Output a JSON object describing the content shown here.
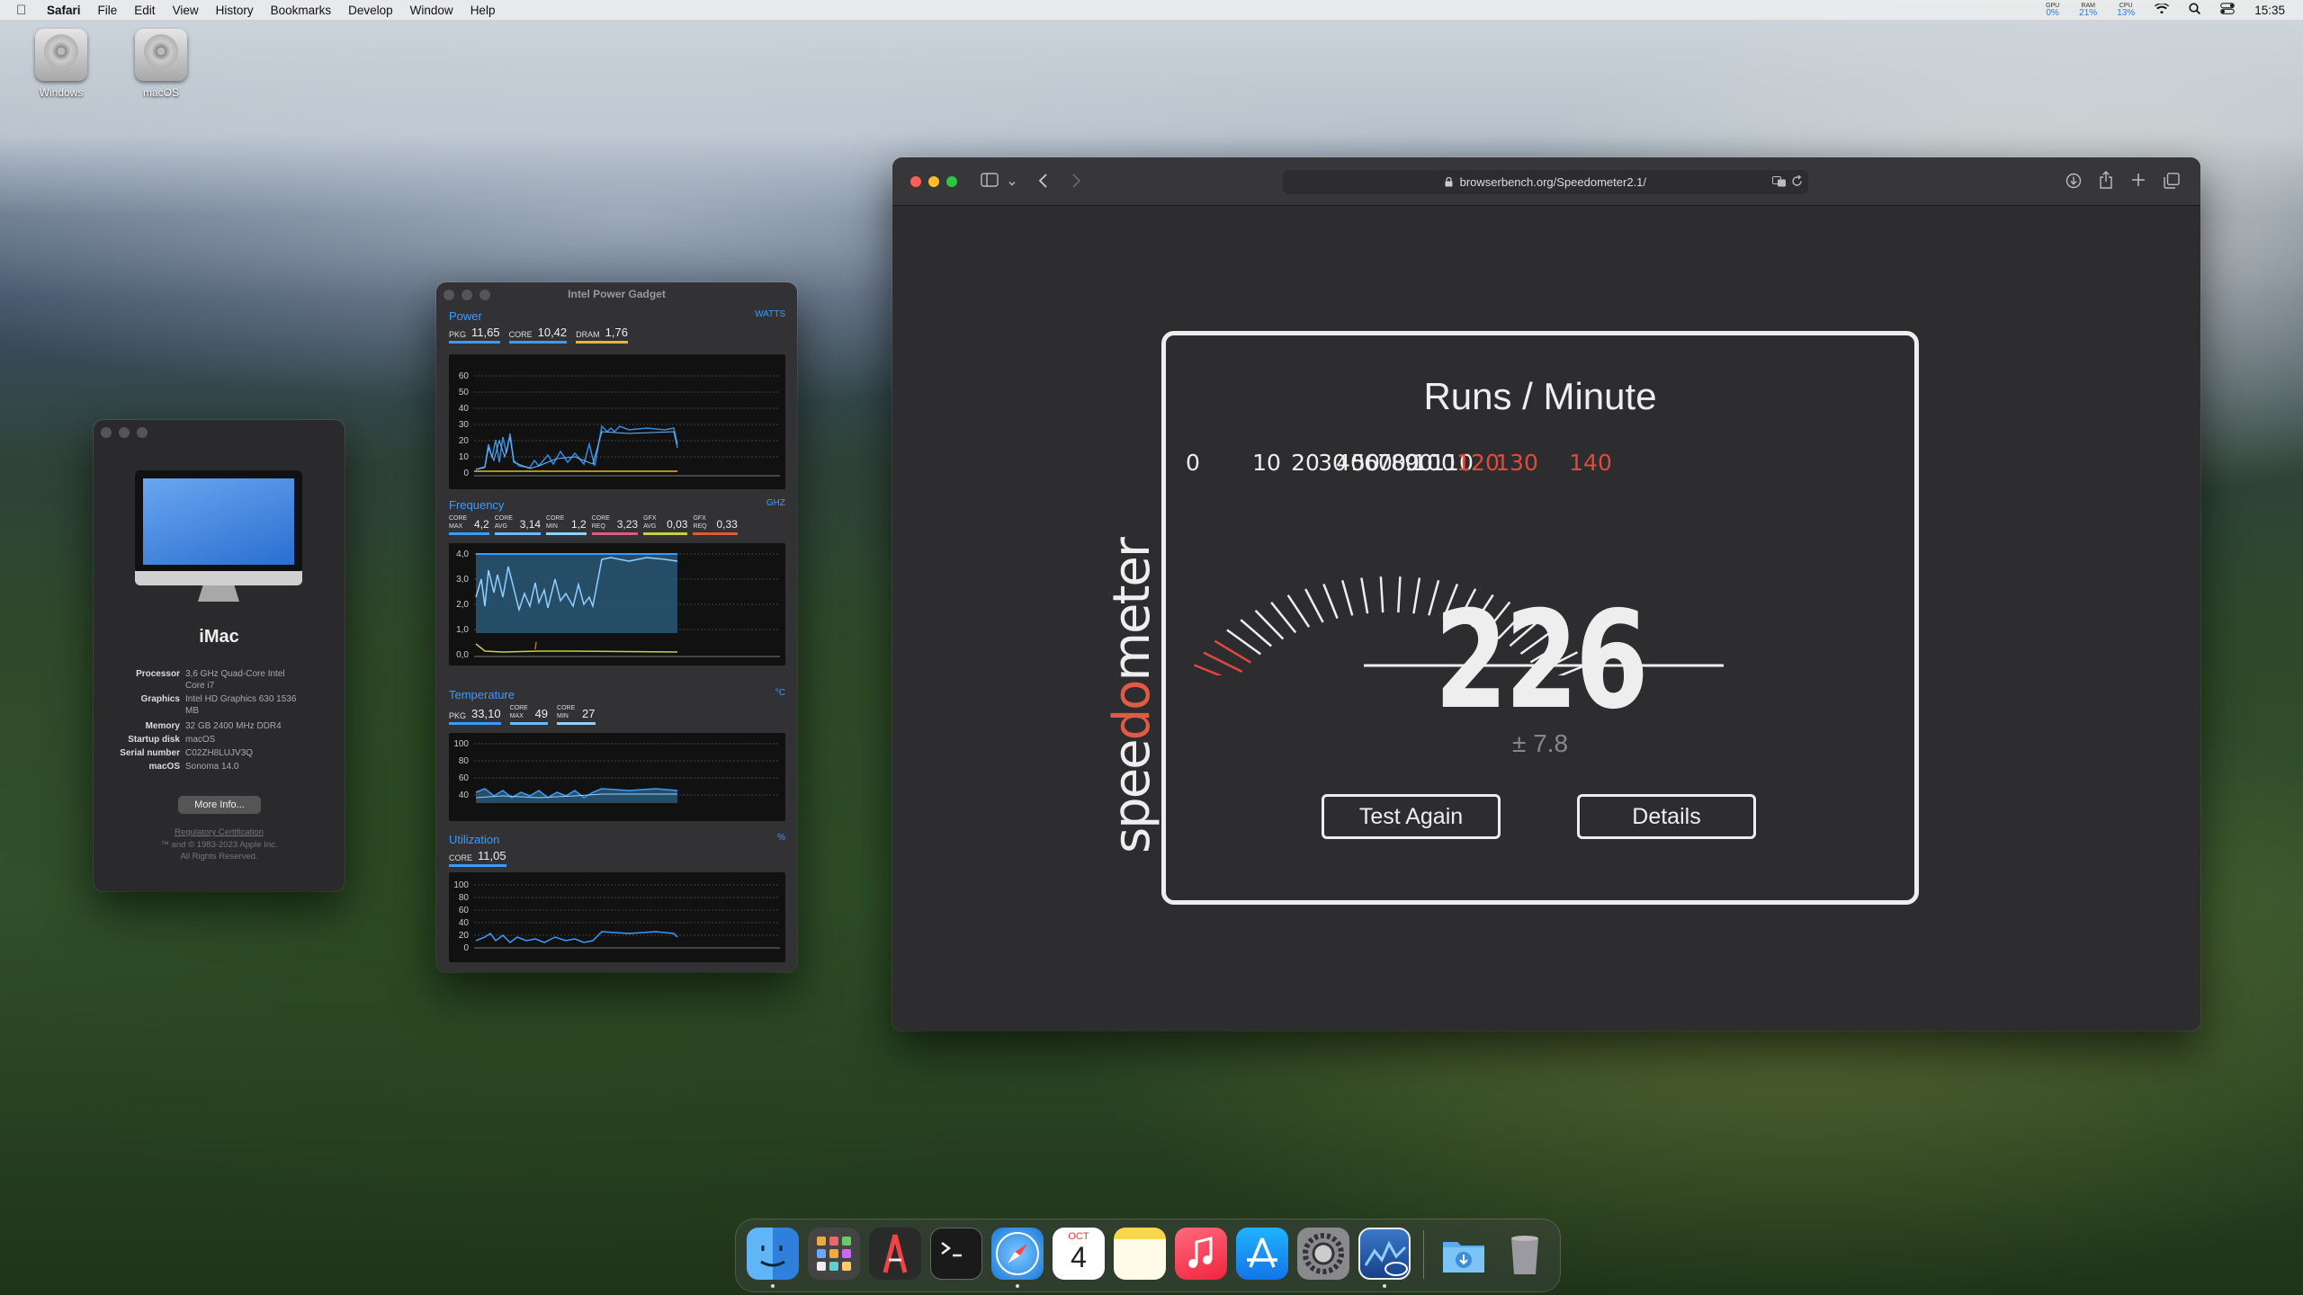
{
  "menubar": {
    "app_name": "Safari",
    "menus": [
      "File",
      "Edit",
      "View",
      "History",
      "Bookmarks",
      "Develop",
      "Window",
      "Help"
    ],
    "stats": [
      {
        "label": "GPU",
        "value": "0%"
      },
      {
        "label": "RAM",
        "value": "21%"
      },
      {
        "label": "CPU",
        "value": "13%"
      }
    ],
    "time": "15:35"
  },
  "desktop": {
    "icons": [
      {
        "label": "Windows"
      },
      {
        "label": "macOS"
      }
    ]
  },
  "about": {
    "model": "iMac",
    "specs": [
      {
        "key": "Processor",
        "value": "3,6 GHz Quad-Core Intel Core i7"
      },
      {
        "key": "Graphics",
        "value": "Intel HD Graphics 630 1536 MB"
      },
      {
        "key": "Memory",
        "value": "32 GB 2400 MHz DDR4"
      },
      {
        "key": "Startup disk",
        "value": "macOS"
      },
      {
        "key": "Serial number",
        "value": "C02ZH8LUJV3Q"
      },
      {
        "key": "macOS",
        "value": "Sonoma 14.0"
      }
    ],
    "more_info": "More Info...",
    "legal1": "Regulatory Certification",
    "legal2": "™ and © 1983-2023 Apple Inc.",
    "legal3": "All Rights Reserved."
  },
  "gadget": {
    "title": "Intel Power Gadget",
    "power": {
      "title": "Power",
      "unit": "WATTS",
      "values": [
        {
          "label": "PKG",
          "value": "11,65"
        },
        {
          "label": "CORE",
          "value": "10,42"
        },
        {
          "label": "DRAM",
          "value": "1,76"
        }
      ],
      "yticks": [
        "60",
        "50",
        "40",
        "30",
        "20",
        "10",
        "0"
      ]
    },
    "frequency": {
      "title": "Frequency",
      "unit": "GHZ",
      "values": [
        {
          "label": "CORE MAX",
          "value": "4,2"
        },
        {
          "label": "CORE AVG",
          "value": "3,14"
        },
        {
          "label": "CORE MIN",
          "value": "1,2"
        },
        {
          "label": "CORE REQ",
          "value": "3,23"
        },
        {
          "label": "GFX AVG",
          "value": "0,03"
        },
        {
          "label": "GFX REQ",
          "value": "0,33"
        }
      ],
      "yticks": [
        "4,0",
        "3,0",
        "2,0",
        "1,0",
        "0,0"
      ]
    },
    "temperature": {
      "title": "Temperature",
      "unit": "°C",
      "values": [
        {
          "label": "PKG",
          "value": "33,10"
        },
        {
          "label": "CORE MAX",
          "value": "49"
        },
        {
          "label": "CORE MIN",
          "value": "27"
        }
      ],
      "yticks": [
        "100",
        "80",
        "60",
        "40"
      ]
    },
    "utilization": {
      "title": "Utilization",
      "unit": "%",
      "values": [
        {
          "label": "CORE",
          "value": "11,05"
        }
      ],
      "yticks": [
        "100",
        "80",
        "60",
        "40",
        "20",
        "0"
      ]
    }
  },
  "safari": {
    "url": "browserbench.org/Speedometer2.1/",
    "page": {
      "logo": "speedometer",
      "heading": "Runs / Minute",
      "gauge_labels": [
        "0",
        "10",
        "20",
        "30",
        "40",
        "50",
        "60",
        "70",
        "80",
        "90",
        "100",
        "110",
        "120",
        "130",
        "140"
      ],
      "score": "226",
      "margin": "± 7.8",
      "test_again": "Test Again",
      "details": "Details"
    }
  },
  "dock": {
    "apps": [
      "Finder",
      "Launchpad",
      "Instruments",
      "Terminal",
      "Safari",
      "Calendar",
      "Notes",
      "Music",
      "App Store",
      "System Settings",
      "Intel Power Gadget",
      "Downloads",
      "Trash"
    ],
    "calendar_month": "OCT",
    "calendar_day": "4"
  },
  "colors": {
    "accent": "#3a9bff",
    "gauge_red": "#e04a3a",
    "gauge_orange": "#f09a30",
    "logo_red": "#e05a45"
  }
}
